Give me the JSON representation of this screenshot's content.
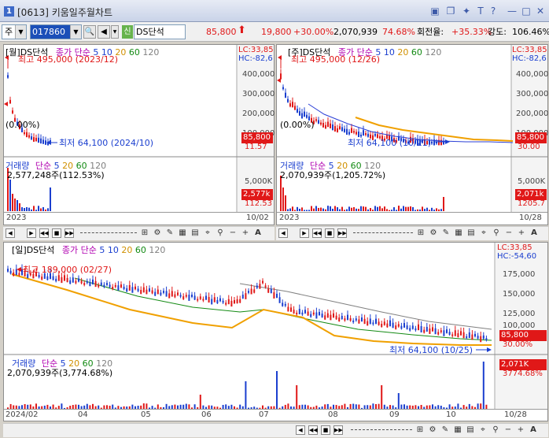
{
  "window": {
    "number": "1",
    "title": "[0613] 키움일주월차트",
    "icons": [
      "chart-layout-icon",
      "copy-icon",
      "pin-icon",
      "text-icon",
      "help-icon",
      "minimize-icon",
      "maximize-icon",
      "close-icon"
    ]
  },
  "toolbar": {
    "market_select": "주",
    "code": "017860",
    "sin_label": "신",
    "stock_name": "DS단석",
    "price": "85,800",
    "change": "19,800",
    "change_pct": "+30.00%",
    "volume": "2,070,939",
    "volume_ratio": "74.68%",
    "turnover_label": "회전율:",
    "turnover": "+35.33%",
    "strength_label": "강도:",
    "strength": "106.46%"
  },
  "monthly": {
    "title": "[월]DS단석",
    "ma_prefix": "종가 단순",
    "ma": [
      "5",
      "10",
      "20",
      "60",
      "120"
    ],
    "lc": "LC:33,85",
    "hc": "HC:-82,6",
    "high": "최고 495,000 (2023/12)",
    "low": "최저 64,100 (2024/10)",
    "zero": "(0.00%)",
    "yticks": [
      "400,000",
      "300,000",
      "200,000",
      "100,000"
    ],
    "price_tag": "85,800",
    "price_pct": "11.57",
    "vol_title": "거래량",
    "vol_ma_prefix": "단순",
    "vol_ma": [
      "5",
      "20",
      "60",
      "120"
    ],
    "vol_info": "2,577,248주(112.53%)",
    "vol_ytick": "5,000K",
    "vol_tag": "2,577k",
    "vol_pct": "112.53",
    "x_start": "2023",
    "x_end": "10/02"
  },
  "weekly": {
    "title": "[주]DS단석",
    "ma_prefix": "종가 단순",
    "ma": [
      "5",
      "10",
      "20",
      "60",
      "120"
    ],
    "lc": "LC:33,85",
    "hc": "HC:-82,6",
    "high": "최고 495,000 (12/26)",
    "low": "최저 64,100 (10/21)",
    "zero": "(0.00%)",
    "yticks": [
      "400,000",
      "300,000",
      "200,000",
      "100,000"
    ],
    "price_tag": "85,800",
    "price_pct": "30.00",
    "vol_title": "거래량",
    "vol_ma_prefix": "단순",
    "vol_ma": [
      "5",
      "20",
      "60",
      "120"
    ],
    "vol_info": "2,070,939주(1,205.72%)",
    "vol_ytick": "5,000K",
    "vol_tag": "2,071k",
    "vol_pct": "1205.7",
    "x_start": "2023",
    "x_end": "10/28"
  },
  "daily": {
    "title": "[일]DS단석",
    "ma_prefix": "종가 단순",
    "ma": [
      "5",
      "10",
      "20",
      "60",
      "120"
    ],
    "lc": "LC:33,85",
    "hc": "HC:-54,60",
    "high": "최고 189,000 (02/27)",
    "low": "최저 64,100 (10/25)",
    "yticks": [
      "175,000",
      "150,000",
      "125,000",
      "100,000"
    ],
    "price_tag": "85,800",
    "price_pct": "30.00%",
    "vol_title": "거래량",
    "vol_ma_prefix": "단순",
    "vol_ma": [
      "5",
      "20",
      "60",
      "120"
    ],
    "vol_info": "2,070,939주(3,774.68%)",
    "vol_tag": "2,071K",
    "vol_pct": "3774.68%",
    "xticks": [
      "2024/02",
      "04",
      "05",
      "06",
      "07",
      "08",
      "09",
      "10"
    ],
    "x_end": "10/28"
  },
  "colors": {
    "up": "#e01818",
    "down": "#1b3fcf",
    "ma5": "#2b3fd6",
    "ma10": "#8a3fb0",
    "ma20": "#f0a000",
    "ma60": "#138a13",
    "ma120": "#808080",
    "ma5_label": "#1b3fcf",
    "ma20_label": "#d09000",
    "ma60_label": "#138a13",
    "ma120_label": "#808080"
  }
}
